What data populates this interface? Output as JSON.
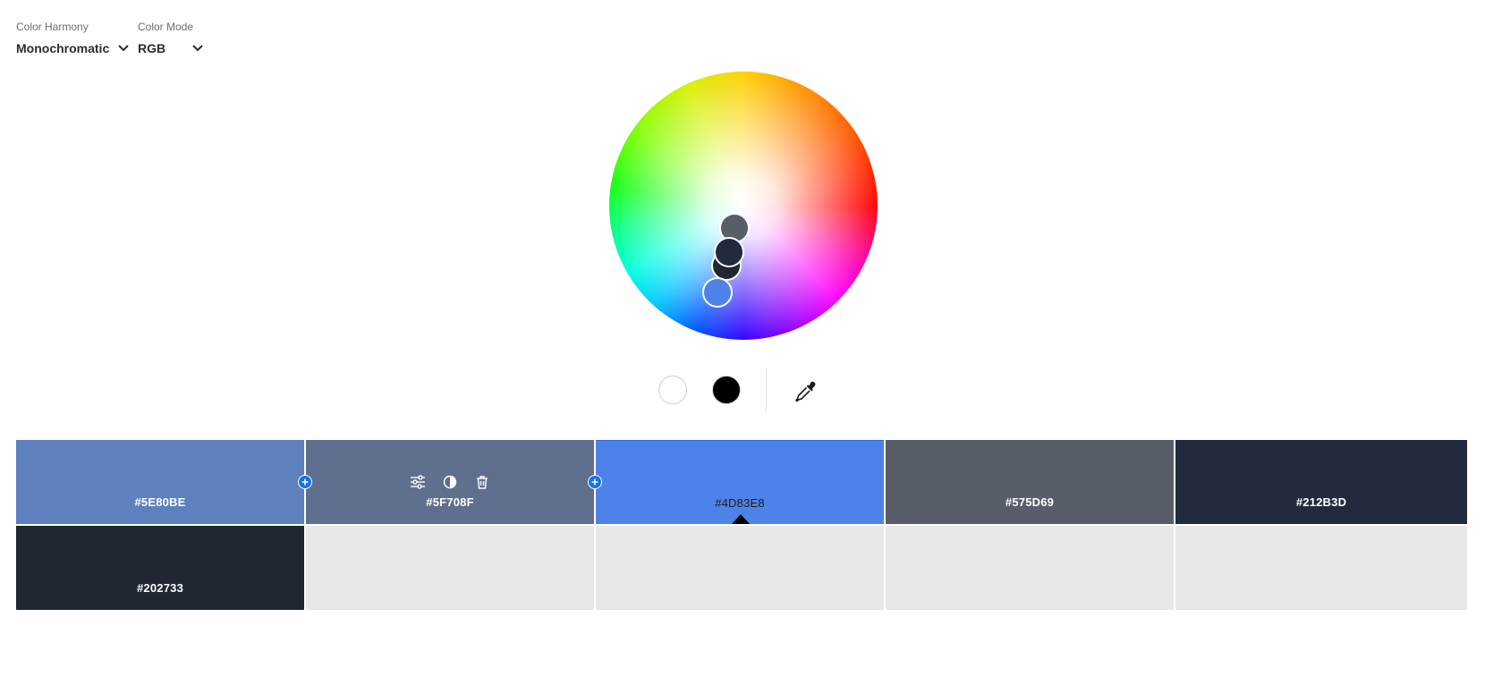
{
  "harmony": {
    "label": "Color Harmony",
    "value": "Monochromatic",
    "chevron_icon": "chevron-down-icon"
  },
  "mode": {
    "label": "Color Mode",
    "value": "RGB",
    "chevron_icon": "chevron-down-icon"
  },
  "wheel": {
    "icon": "color-wheel",
    "marker_colors": [
      "#575D69",
      "#212B3D",
      "#202733",
      "#4D83E8"
    ]
  },
  "tools": {
    "white_swatch_icon": "white-circle",
    "black_swatch_icon": "black-circle",
    "eyedropper_icon": "eyedropper-icon"
  },
  "swatches": [
    {
      "hex": "#5E80BE",
      "color": "#5E80BE"
    },
    {
      "hex": "#5F708F",
      "color": "#5F708F"
    },
    {
      "hex": "#4D83E8",
      "color": "#4D83E8",
      "selected": true
    },
    {
      "hex": "#575D69",
      "color": "#575D69"
    },
    {
      "hex": "#212B3D",
      "color": "#212B3D"
    },
    {
      "hex": "#202733",
      "color": "#202733"
    },
    {
      "hex": "",
      "color": "#E8E8E8"
    },
    {
      "hex": "",
      "color": "#E8E8E8"
    },
    {
      "hex": "",
      "color": "#E8E8E8"
    },
    {
      "hex": "",
      "color": "#E8E8E8"
    }
  ],
  "swatch_tool_icons": [
    "sliders-icon",
    "contrast-icon",
    "trash-icon"
  ],
  "add_icon": "plus-icon"
}
